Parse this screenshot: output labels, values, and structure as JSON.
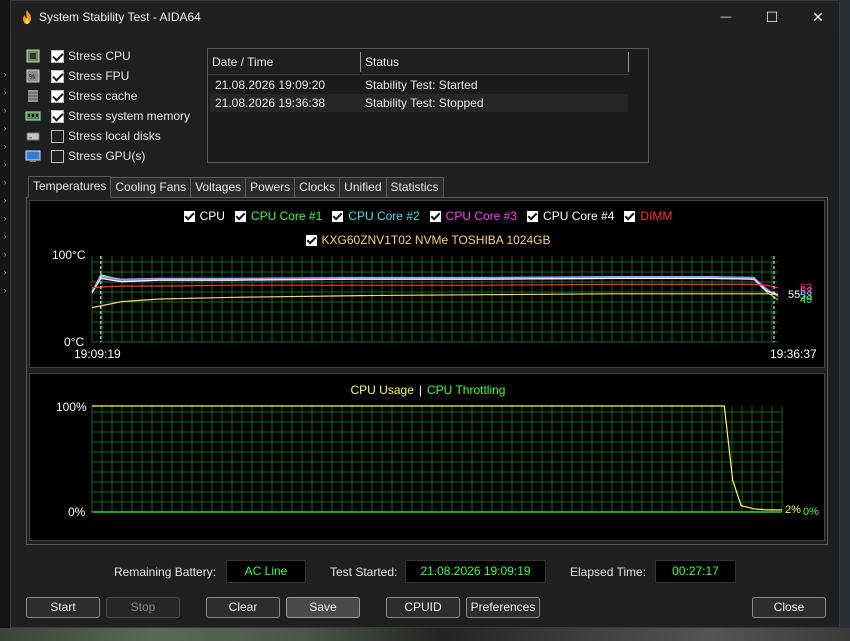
{
  "window": {
    "title": "System Stability Test - AIDA64",
    "minimize_symbol": "—",
    "maximize_symbol": "☐",
    "close_symbol": "✕",
    "app_icon": "flame-icon"
  },
  "stress": [
    {
      "label": "Stress CPU",
      "checked": true,
      "icon": "cpu-icon"
    },
    {
      "label": "Stress FPU",
      "checked": true,
      "icon": "fpu-icon"
    },
    {
      "label": "Stress cache",
      "checked": true,
      "icon": "cache-icon"
    },
    {
      "label": "Stress system memory",
      "checked": true,
      "icon": "memory-icon"
    },
    {
      "label": "Stress local disks",
      "checked": false,
      "icon": "disk-icon"
    },
    {
      "label": "Stress GPU(s)",
      "checked": false,
      "icon": "gpu-icon"
    }
  ],
  "log": {
    "headers": [
      "Date / Time",
      "Status"
    ],
    "rows": [
      {
        "datetime": "21.08.2026 19:09:20",
        "status": "Stability Test: Started"
      },
      {
        "datetime": "21.08.2026 19:36:38",
        "status": "Stability Test: Stopped"
      }
    ]
  },
  "tabs": [
    {
      "label": "Temperatures",
      "active": true
    },
    {
      "label": "Cooling Fans",
      "active": false
    },
    {
      "label": "Voltages",
      "active": false
    },
    {
      "label": "Powers",
      "active": false
    },
    {
      "label": "Clocks",
      "active": false
    },
    {
      "label": "Unified",
      "active": false
    },
    {
      "label": "Statistics",
      "active": false
    }
  ],
  "chart_data": [
    {
      "type": "line",
      "legend": [
        {
          "name": "CPU",
          "color": "#ffffff"
        },
        {
          "name": "CPU Core #1",
          "color": "#3cff3c"
        },
        {
          "name": "CPU Core #2",
          "color": "#40e0f0"
        },
        {
          "name": "CPU Core #3",
          "color": "#ff40ff"
        },
        {
          "name": "CPU Core #4",
          "color": "#ffffff"
        },
        {
          "name": "DIMM",
          "color": "#ff3030"
        },
        {
          "name": "KXG60ZNV1T02 NVMe TOSHIBA 1024GB",
          "color": "#ffd27a"
        }
      ],
      "ymax_label": "100°C",
      "ymin_label": "0°C",
      "ylim": [
        0,
        100
      ],
      "x_start_label": "19:09:19",
      "x_end_label": "19:36:37",
      "x": [
        "19:09:19",
        "19:09:40",
        "19:10:30",
        "19:12:00",
        "19:15:00",
        "19:20:00",
        "19:25:00",
        "19:30:00",
        "19:34:00",
        "19:35:40",
        "19:36:10",
        "19:36:37"
      ],
      "series": [
        {
          "name": "CPU",
          "color": "#ffffff",
          "values": [
            58,
            78,
            72,
            73,
            73,
            74,
            74,
            75,
            75,
            74,
            60,
            55
          ]
        },
        {
          "name": "CPU Core #1",
          "color": "#3cff3c",
          "values": [
            57,
            76,
            71,
            72,
            72,
            73,
            73,
            74,
            74,
            73,
            58,
            49
          ]
        },
        {
          "name": "CPU Core #2",
          "color": "#40e0f0",
          "values": [
            59,
            77,
            73,
            74,
            74,
            75,
            75,
            76,
            76,
            75,
            61,
            53
          ]
        },
        {
          "name": "CPU Core #3",
          "color": "#ff40ff",
          "values": [
            58,
            75,
            72,
            73,
            73,
            74,
            74,
            75,
            75,
            74,
            62,
            53
          ]
        },
        {
          "name": "CPU Core #4",
          "color": "#ffffff",
          "values": [
            57,
            74,
            70,
            72,
            72,
            73,
            73,
            74,
            74,
            73,
            59,
            55
          ]
        },
        {
          "name": "DIMM",
          "color": "#ff3030",
          "values": [
            63,
            64,
            65,
            65,
            66,
            66,
            66,
            67,
            67,
            67,
            66,
            63
          ]
        },
        {
          "name": "KXG60ZNV1T02 NVMe TOSHIBA 1024GB",
          "color": "#ffd27a",
          "values": [
            40,
            42,
            47,
            50,
            52,
            54,
            55,
            56,
            56,
            56,
            56,
            55
          ]
        }
      ],
      "end_labels": [
        "63",
        "55",
        "53",
        "53",
        "49"
      ],
      "end_label_colors": [
        "#ff3030",
        "#ffffff",
        "#ff40ff",
        "#40e0f0",
        "#3cff3c"
      ],
      "grid": true
    },
    {
      "type": "line",
      "legend": [
        {
          "name": "CPU Usage",
          "color": "#ffff40"
        },
        {
          "name": "CPU Throttling",
          "color": "#3cff3c"
        }
      ],
      "legend_sep": "|",
      "ymax_label": "100%",
      "ymin_label": "0%",
      "ylim": [
        0,
        100
      ],
      "x": [
        "19:09:19",
        "19:34:00",
        "19:34:20",
        "19:34:40",
        "19:35:00",
        "19:35:30",
        "19:36:00",
        "19:36:37"
      ],
      "series": [
        {
          "name": "CPU Usage",
          "color": "#ffff40",
          "values": [
            100,
            100,
            100,
            30,
            6,
            3,
            2,
            2
          ]
        },
        {
          "name": "CPU Throttling",
          "color": "#3cff3c",
          "values": [
            0,
            0,
            0,
            0,
            0,
            0,
            0,
            0
          ]
        }
      ],
      "end_labels": [
        "2%",
        "0%"
      ],
      "end_label_colors": [
        "#ffff40",
        "#3cff3c"
      ],
      "grid": true
    }
  ],
  "info": {
    "battery_label": "Remaining Battery:",
    "battery_value": "AC Line",
    "started_label": "Test Started:",
    "started_value": "21.08.2026 19:09:19",
    "elapsed_label": "Elapsed Time:",
    "elapsed_value": "00:27:17"
  },
  "buttons": {
    "start": "Start",
    "stop": "Stop",
    "clear": "Clear",
    "save": "Save",
    "cpuid": "CPUID",
    "preferences": "Preferences",
    "close": "Close"
  }
}
